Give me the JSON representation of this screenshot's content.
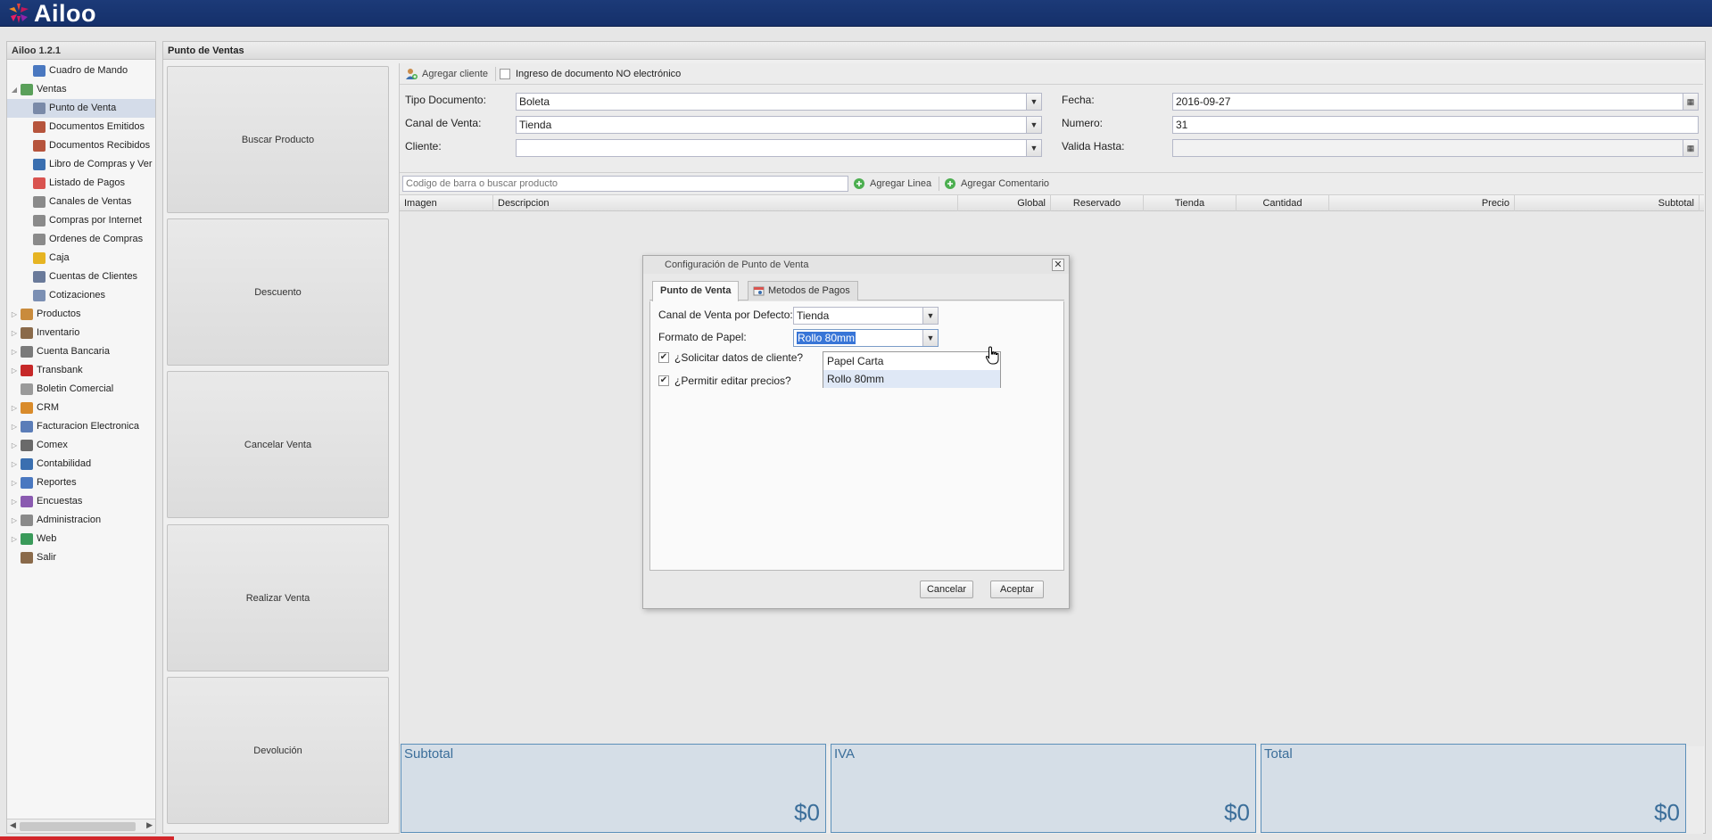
{
  "app": {
    "logo_text": "Ailoo",
    "version": "Ailoo 1.2.1"
  },
  "sidebar": {
    "items": [
      {
        "label": "Cuadro de Mando",
        "icon": "chart-bars-icon",
        "level": 1,
        "expandable": false,
        "selected": false
      },
      {
        "label": "Ventas",
        "icon": "money-icon",
        "level": 0,
        "expandable": true,
        "expanded": true,
        "selected": false
      },
      {
        "label": "Punto de Venta",
        "icon": "register-icon",
        "level": 1,
        "expandable": false,
        "selected": true
      },
      {
        "label": "Documentos Emitidos",
        "icon": "document-icon",
        "level": 1,
        "expandable": false,
        "selected": false
      },
      {
        "label": "Documentos Recibidos",
        "icon": "document-icon",
        "level": 1,
        "expandable": false,
        "selected": false
      },
      {
        "label": "Libro de Compras y Ver",
        "icon": "book-icon",
        "level": 1,
        "expandable": false,
        "selected": false
      },
      {
        "label": "Listado de Pagos",
        "icon": "payments-icon",
        "level": 1,
        "expandable": false,
        "selected": false
      },
      {
        "label": "Canales de Ventas",
        "icon": "cart-icon",
        "level": 1,
        "expandable": false,
        "selected": false
      },
      {
        "label": "Compras por Internet",
        "icon": "cart-icon",
        "level": 1,
        "expandable": false,
        "selected": false
      },
      {
        "label": "Ordenes de Compras",
        "icon": "cart-icon",
        "level": 1,
        "expandable": false,
        "selected": false
      },
      {
        "label": "Caja",
        "icon": "coins-icon",
        "level": 1,
        "expandable": false,
        "selected": false
      },
      {
        "label": "Cuentas de Clientes",
        "icon": "accounts-icon",
        "level": 1,
        "expandable": false,
        "selected": false
      },
      {
        "label": "Cotizaciones",
        "icon": "quote-icon",
        "level": 1,
        "expandable": false,
        "selected": false
      },
      {
        "label": "Productos",
        "icon": "box-icon",
        "level": 0,
        "expandable": true,
        "selected": false
      },
      {
        "label": "Inventario",
        "icon": "inventory-icon",
        "level": 0,
        "expandable": true,
        "selected": false
      },
      {
        "label": "Cuenta Bancaria",
        "icon": "bank-icon",
        "level": 0,
        "expandable": true,
        "selected": false
      },
      {
        "label": "Transbank",
        "icon": "transbank-icon",
        "level": 0,
        "expandable": true,
        "selected": false
      },
      {
        "label": "Boletin Comercial",
        "icon": "tag-icon",
        "level": 0,
        "expandable": false,
        "selected": false
      },
      {
        "label": "CRM",
        "icon": "crm-icon",
        "level": 0,
        "expandable": true,
        "selected": false
      },
      {
        "label": "Facturacion Electronica",
        "icon": "invoice-icon",
        "level": 0,
        "expandable": true,
        "selected": false
      },
      {
        "label": "Comex",
        "icon": "truck-icon",
        "level": 0,
        "expandable": true,
        "selected": false
      },
      {
        "label": "Contabilidad",
        "icon": "calculator-icon",
        "level": 0,
        "expandable": true,
        "selected": false
      },
      {
        "label": "Reportes",
        "icon": "chart-bars-icon",
        "level": 0,
        "expandable": true,
        "selected": false
      },
      {
        "label": "Encuestas",
        "icon": "survey-icon",
        "level": 0,
        "expandable": true,
        "selected": false
      },
      {
        "label": "Administracion",
        "icon": "gear-icon",
        "level": 0,
        "expandable": true,
        "selected": false
      },
      {
        "label": "Web",
        "icon": "globe-icon",
        "level": 0,
        "expandable": true,
        "selected": false
      },
      {
        "label": "Salir",
        "icon": "exit-icon",
        "level": 0,
        "expandable": false,
        "selected": false
      }
    ]
  },
  "main": {
    "title": "Punto de Ventas",
    "actions": [
      "Buscar Producto",
      "Descuento",
      "Cancelar Venta",
      "Realizar Venta",
      "Devolución"
    ],
    "toolbar": {
      "add_client": "Agregar cliente",
      "no_electronic": "Ingreso de documento NO electrónico"
    },
    "form": {
      "tipo_documento_label": "Tipo Documento:",
      "tipo_documento_value": "Boleta",
      "canal_venta_label": "Canal de Venta:",
      "canal_venta_value": "Tienda",
      "cliente_label": "Cliente:",
      "cliente_value": "",
      "fecha_label": "Fecha:",
      "fecha_value": "2016-09-27",
      "numero_label": "Numero:",
      "numero_value": "31",
      "valida_hasta_label": "Valida Hasta:",
      "valida_hasta_value": ""
    },
    "product_bar": {
      "search_placeholder": "Codigo de barra o buscar producto",
      "add_line": "Agregar Linea",
      "add_comment": "Agregar Comentario"
    },
    "grid_columns": [
      "Imagen",
      "Descripcion",
      "Global",
      "Reservado",
      "Tienda",
      "Cantidad",
      "Precio",
      "Subtotal"
    ],
    "totals": [
      {
        "label": "Subtotal",
        "value": "$0"
      },
      {
        "label": "IVA",
        "value": "$0"
      },
      {
        "label": "Total",
        "value": "$0"
      }
    ]
  },
  "dialog": {
    "title": "Configuración de Punto de Venta",
    "tabs": [
      "Punto de Venta",
      "Metodos de Pagos"
    ],
    "canal_label": "Canal de Venta por Defecto:",
    "canal_value": "Tienda",
    "formato_label": "Formato de Papel:",
    "formato_value": "Rollo 80mm",
    "solicitar_label": "¿Solicitar datos de cliente?",
    "solicitar_checked": true,
    "editar_label": "¿Permitir editar precios?",
    "editar_checked": true,
    "dropdown_options": [
      "Papel Carta",
      "Rollo 80mm"
    ],
    "cancel": "Cancelar",
    "accept": "Aceptar"
  },
  "colors": {
    "topbar": "#1c3a78",
    "accent": "#3b6e9a",
    "selected_row": "#d4dce9"
  }
}
